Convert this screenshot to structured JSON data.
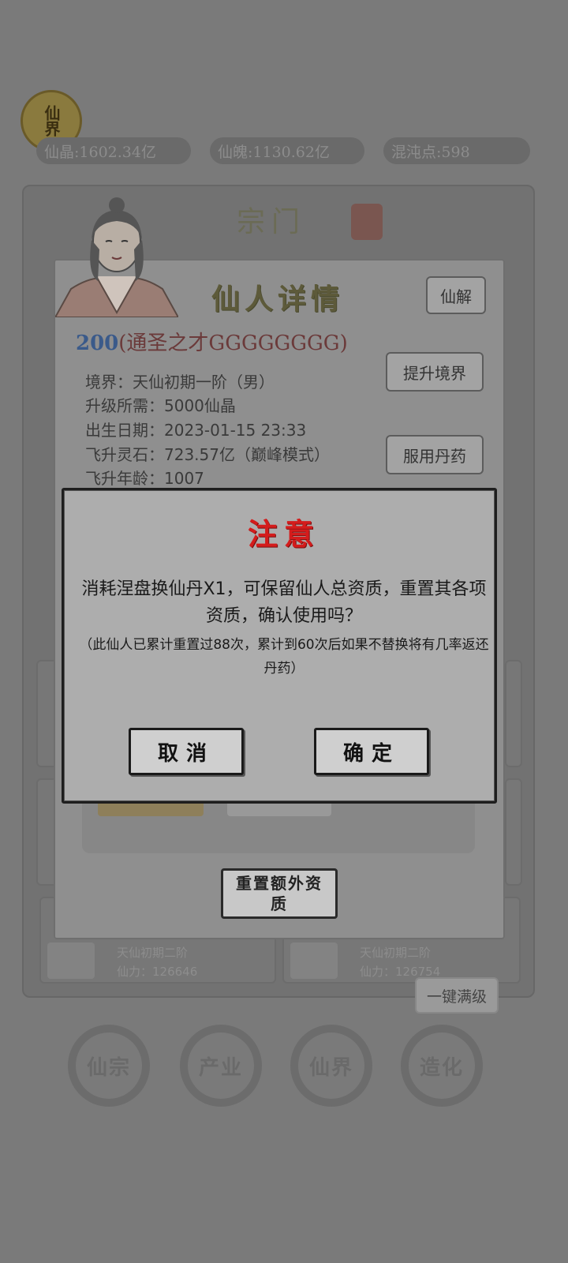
{
  "background": {
    "realm_badge": "仙界",
    "resources": [
      {
        "label": "仙晶:1602.34亿"
      },
      {
        "label": "仙魄:1130.62亿"
      },
      {
        "label": "混沌点:598"
      }
    ],
    "section_title": "宗门",
    "cards": [
      {
        "name": "天仙初期二阶",
        "power": "仙力：126646"
      },
      {
        "name": "天仙初期二阶",
        "power": "仙力：126754"
      }
    ],
    "one_key_max": "一键满级",
    "nav": [
      {
        "label": "仙宗"
      },
      {
        "label": "产业"
      },
      {
        "label": "仙界"
      },
      {
        "label": "造化"
      }
    ]
  },
  "detail": {
    "title": "仙人详情",
    "xianjie_button": "仙解",
    "aptitude_number": "200",
    "aptitude_text": "(通圣之才GGGGGGGG)",
    "info": [
      "境界：天仙初期一阶（男）",
      "升级所需：5000仙晶",
      "出生日期：2023-01-15 23:33",
      "飞升灵石：723.57亿（巅峰模式）",
      "飞升年龄：1007"
    ],
    "upgrade_button": "提升境界",
    "pill_button": "服用丹药",
    "reset_extra_button": "重置额外资质"
  },
  "modal": {
    "title": "注意",
    "message": "消耗涅盘换仙丹X1，可保留仙人总资质，重置其各项资质，确认使用吗？",
    "note": "（此仙人已累计重置过88次，累计到60次后如果不替换将有几率返还丹药）",
    "cancel": "取消",
    "confirm": "确定"
  }
}
